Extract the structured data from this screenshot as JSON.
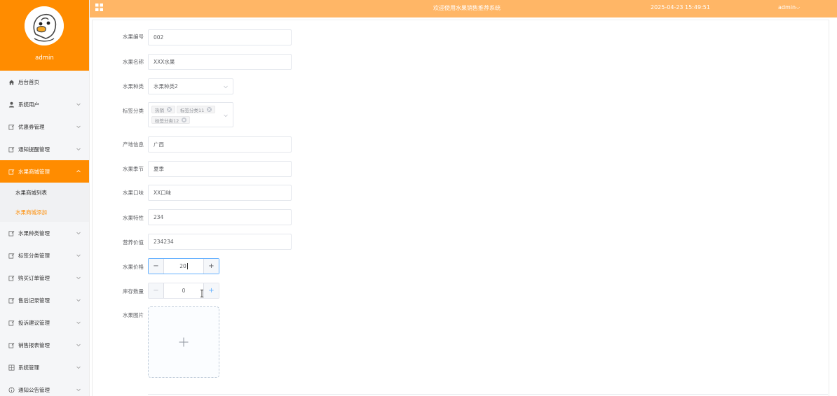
{
  "profile": {
    "name": "admin"
  },
  "topbar": {
    "title": "欢迎使用水果销售推荐系统",
    "datetime": "2025-04-23 15:49:51",
    "user": "admin",
    "user_caret": "⌵"
  },
  "menu": {
    "items": [
      {
        "label": "后台首页",
        "icon": "home-icon"
      },
      {
        "label": "系统用户",
        "icon": "user-icon"
      },
      {
        "label": "优惠券管理",
        "icon": "edit-icon"
      },
      {
        "label": "通知提醒管理",
        "icon": "edit-icon"
      },
      {
        "label": "水果商城管理",
        "icon": "edit-icon",
        "active": true
      },
      {
        "label": "水果种类管理",
        "icon": "edit-icon"
      },
      {
        "label": "标签分类管理",
        "icon": "edit-icon"
      },
      {
        "label": "购买订单管理",
        "icon": "edit-icon"
      },
      {
        "label": "售后记录管理",
        "icon": "edit-icon"
      },
      {
        "label": "投诉建议管理",
        "icon": "edit-icon"
      },
      {
        "label": "销售报表管理",
        "icon": "edit-icon"
      },
      {
        "label": "系统管理",
        "icon": "grid-icon"
      },
      {
        "label": "通知公告管理",
        "icon": "info-icon"
      }
    ],
    "submenu": [
      {
        "label": "水果商城列表"
      },
      {
        "label": "水果商城添加",
        "current": true
      }
    ]
  },
  "form": {
    "code": {
      "label": "水果编号",
      "value": "002"
    },
    "name": {
      "label": "水果名称",
      "value": "XXX水果"
    },
    "category": {
      "label": "水果种类",
      "value": "水果种类2"
    },
    "tags": {
      "label": "标签分类",
      "values": [
        "热销",
        "标签分类11",
        "标签分类12"
      ]
    },
    "origin": {
      "label": "产地信息",
      "value": "广西"
    },
    "season": {
      "label": "水果季节",
      "value": "夏季"
    },
    "flavor": {
      "label": "水果口味",
      "value": "XX口味"
    },
    "feature": {
      "label": "水果特性",
      "value": "234"
    },
    "nutrition": {
      "label": "营养价值",
      "value": "234234"
    },
    "price": {
      "label": "水果价格",
      "value": "20",
      "minus": "−",
      "plus": "+"
    },
    "stock": {
      "label": "库存数量",
      "value": "0",
      "minus": "−",
      "plus": "+"
    },
    "image": {
      "label": "水果图片"
    }
  },
  "colors": {
    "accent": "#ff8c00",
    "topbar": "#ffb666",
    "focus": "#66b1ff"
  }
}
